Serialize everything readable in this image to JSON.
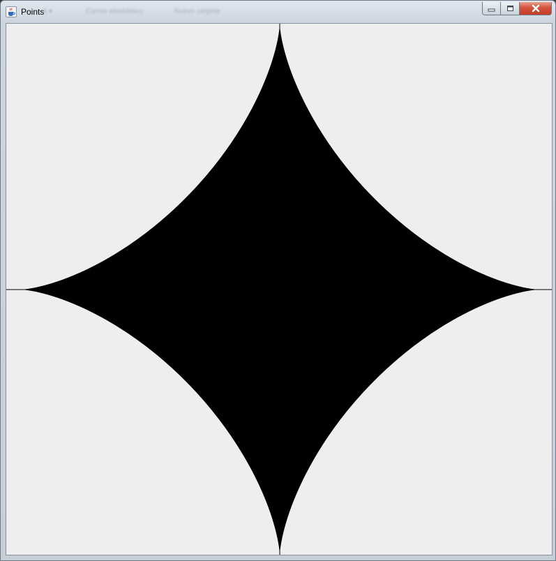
{
  "window": {
    "title": "Points",
    "background_ghost_text": [
      "A ▾",
      "Correo electrónico",
      "Nuevo carpeta"
    ]
  },
  "canvas": {
    "shape": "astroid",
    "fill_color": "#000000",
    "background_color": "#eeeeee",
    "axes_color": "#000000"
  },
  "icons": {
    "app": "java-coffee-icon",
    "minimize": "minimize-icon",
    "maximize": "maximize-icon",
    "close": "close-icon"
  }
}
